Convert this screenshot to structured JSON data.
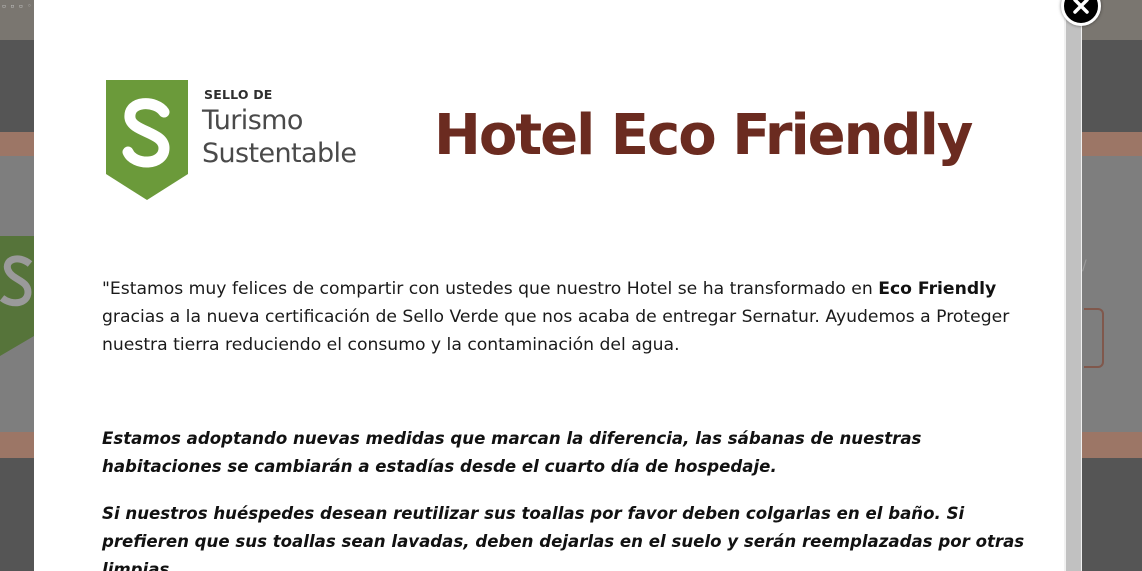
{
  "background_page": {
    "topbar_text": "▫ ▫ ▫ ◦ ◦ ◦"
  },
  "modal": {
    "seal": {
      "line_small": "SELLO DE",
      "line_1": "Turismo",
      "line_2": "Sustentable",
      "shield_color": "#6b9a3a"
    },
    "title": "Hotel Eco Friendly",
    "intro": {
      "text_before": "\"Estamos muy felices de compartir con ustedes que nuestro Hotel se ha transformado en ",
      "bold": "Eco Friendly",
      "text_after": " gracias a la nueva certificación de Sello Verde que nos acaba de entregar Sernatur. Ayudemos a Proteger nuestra tierra reduciendo el consumo y la contaminación del agua."
    },
    "notes": [
      "Estamos adoptando nuevas medidas que marcan la diferencia, las sábanas de nuestras habitaciones se cambiarán a estadías desde el cuarto día de hospedaje.",
      "Si nuestros huéspedes desean reutilizar sus toallas por favor deben colgarlas en el baño. Si prefieren que sus toallas sean lavadas, deben dejarlas en el suelo y serán reemplazadas por otras limpias."
    ],
    "close_icon": "close-icon"
  },
  "colors": {
    "title": "#6b2b20",
    "seal_green": "#6b9a3a",
    "background_tan": "#9c7666"
  }
}
